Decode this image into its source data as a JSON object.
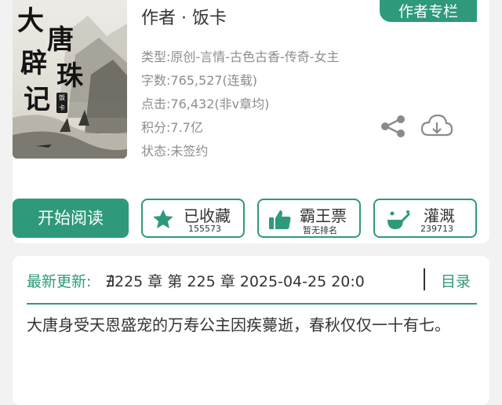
{
  "book": {
    "cover_title_chars": [
      "大",
      "唐",
      "辟",
      "珠",
      "记"
    ],
    "cover_stamp": "饭卡",
    "author_line": "作者 · 饭卡",
    "author_column_button": "作者专栏",
    "meta": {
      "type": "类型:原创-言情-古色古香-传奇-女主",
      "word_count": "字数:765,527(连载)",
      "clicks": "点击:76,432(非v章均)",
      "points": "积分:7.7亿",
      "status": "状态:未签约"
    }
  },
  "actions": {
    "read_label": "开始阅读",
    "collect_label": "已收藏",
    "collect_count": "155573",
    "vote_label": "霸王票",
    "vote_sub": "暂无排名",
    "water_label": "灌溉",
    "water_count": "239713"
  },
  "icons": [
    "share-icon",
    "download-icon",
    "star-icon",
    "thumbs-up-icon",
    "watering-icon"
  ],
  "colors": {
    "accent": "#2e9a7b"
  },
  "update": {
    "label": "最新更新:",
    "chapter": "∄225 章 第 225 章 2025-04-25 20:0",
    "toc_label": "目录"
  },
  "intro": "大唐身受天恩盛宠的万寿公主因疾薨逝，春秋仅仅一十有七。"
}
